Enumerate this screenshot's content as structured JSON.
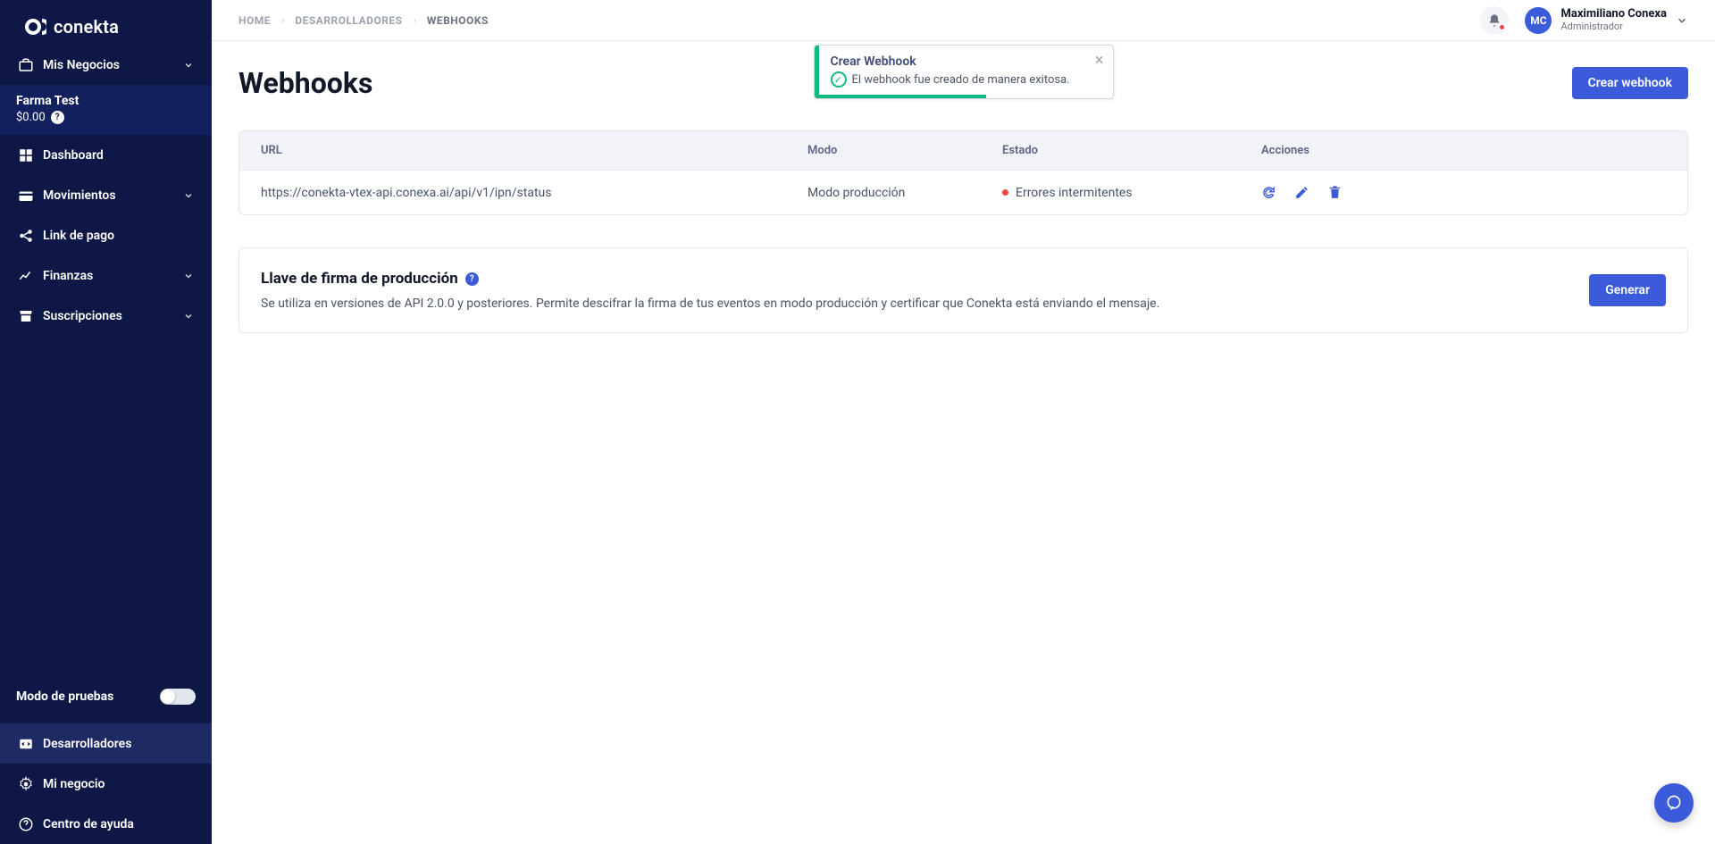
{
  "brand": "conekta",
  "sidebar": {
    "businesses": {
      "label": "Mis Negocios"
    },
    "account": {
      "name": "Farma Test",
      "balance": "$0.00"
    },
    "items": {
      "dashboard": "Dashboard",
      "movimientos": "Movimientos",
      "link_de_pago": "Link de pago",
      "finanzas": "Finanzas",
      "suscripciones": "Suscripciones"
    },
    "bottom": {
      "test_mode": "Modo de pruebas",
      "desarrolladores": "Desarrolladores",
      "mi_negocio": "Mi negocio",
      "centro_ayuda": "Centro de ayuda"
    }
  },
  "breadcrumb": {
    "home": "HOME",
    "dev": "DESARROLLADORES",
    "webhooks": "WEBHOOKS"
  },
  "user": {
    "initials": "MC",
    "name": "Maximiliano Conexa",
    "role": "Administrador"
  },
  "page": {
    "title": "Webhooks",
    "create_btn": "Crear webhook"
  },
  "table": {
    "headers": {
      "url": "URL",
      "mode": "Modo",
      "status": "Estado",
      "actions": "Acciones"
    },
    "rows": [
      {
        "url": "https://conekta-vtex-api.conexa.ai/api/v1/ipn/status",
        "mode": "Modo producción",
        "status": "Errores intermitentes"
      }
    ]
  },
  "panel": {
    "title": "Llave de firma de producción",
    "desc": "Se utiliza en versiones de API 2.0.0 y posteriores. Permite descifrar la firma de tus eventos en modo producción y certificar que Conekta está enviando el mensaje.",
    "btn": "Generar"
  },
  "toast": {
    "title": "Crear Webhook",
    "message": "El webhook fue creado de manera exitosa."
  }
}
